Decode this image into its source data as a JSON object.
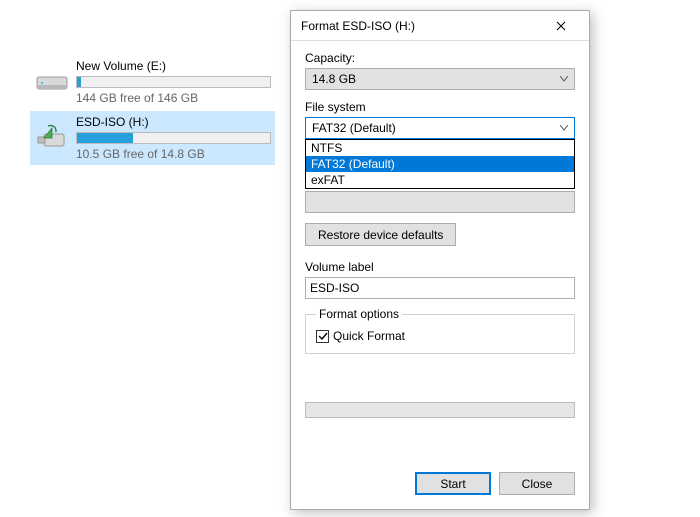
{
  "drives": [
    {
      "name": "New Volume (E:)",
      "free_text": "144 GB free of 146 GB",
      "fill_pct": 2,
      "selected": false,
      "kind": "hdd"
    },
    {
      "name": "ESD-ISO (H:)",
      "free_text": "10.5 GB free of 14.8 GB",
      "fill_pct": 29,
      "selected": true,
      "kind": "usb"
    }
  ],
  "dialog": {
    "title": "Format ESD-ISO (H:)",
    "capacity_label": "Capacity:",
    "capacity_value": "14.8 GB",
    "filesystem_label": "File system",
    "filesystem_value": "FAT32 (Default)",
    "filesystem_options": [
      "NTFS",
      "FAT32 (Default)",
      "exFAT"
    ],
    "filesystem_highlight_index": 1,
    "restore_defaults": "Restore device defaults",
    "volume_label_label": "Volume label",
    "volume_label_value": "ESD-ISO",
    "format_options_label": "Format options",
    "quick_format_label": "Quick Format",
    "quick_format_checked": true,
    "start": "Start",
    "close": "Close"
  }
}
